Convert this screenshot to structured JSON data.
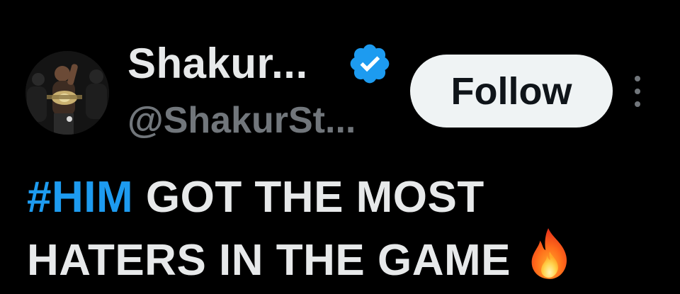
{
  "tweet": {
    "author": {
      "display_name": "Shakur...",
      "handle": "@ShakurSt...",
      "verified": true
    },
    "follow_label": "Follow",
    "body": {
      "hashtag": "#HIM",
      "line1_rest": "GOT THE MOST",
      "line2": "HATERS IN THE GAME",
      "emoji": "fire-icon"
    }
  },
  "colors": {
    "background": "#000000",
    "text_primary": "#e7e9ea",
    "text_secondary": "#71767b",
    "link": "#1d9bf0",
    "verified_badge": "#1d9bf0",
    "follow_button_bg": "#eff3f4"
  }
}
